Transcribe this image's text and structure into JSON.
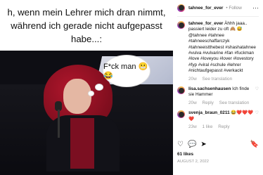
{
  "media": {
    "caption_lines": [
      "h, wenn mein Lehrer mich dran nimmt,",
      "während ich gerade nicht aufgepasst",
      "habe...:"
    ],
    "bubble_text": "F*ck man 😬😂"
  },
  "post": {
    "username": "tahnee_for_ever",
    "follow_label": "• Follow",
    "menu_icon": "more-icon",
    "caption_user": "tahnee_for_ever",
    "caption_text": "Ähhh jaaa.. passiert leider zu oft 🙈 😅 @tahnee #tahnee #tahneeschaffarczyk #tahneeistthebest #shashatahnee #vulva #vulvarine #fan #fuckman #love #loveyou #lover #lovestory #fyp #viral #schule #lehrer #nichtaufgepasst #verkackt",
    "caption_meta": {
      "time": "20w",
      "see_translation": "See translation"
    },
    "comments": [
      {
        "username": "lisa.sachsenhausen",
        "text": "Ich finde sie Hammer",
        "time": "20w",
        "reply": "Reply",
        "see_translation": "See translation"
      },
      {
        "username": "svenja_braun_0211",
        "text": "😂❤️❤️❤️❤️",
        "time": "23w",
        "likes": "1 like",
        "reply": "Reply"
      }
    ],
    "likes": "61 likes",
    "date": "AUGUST 2, 2022"
  },
  "colors": {
    "accent": "#0095f6",
    "muted": "#9a9a9a",
    "dark": "#111111"
  }
}
